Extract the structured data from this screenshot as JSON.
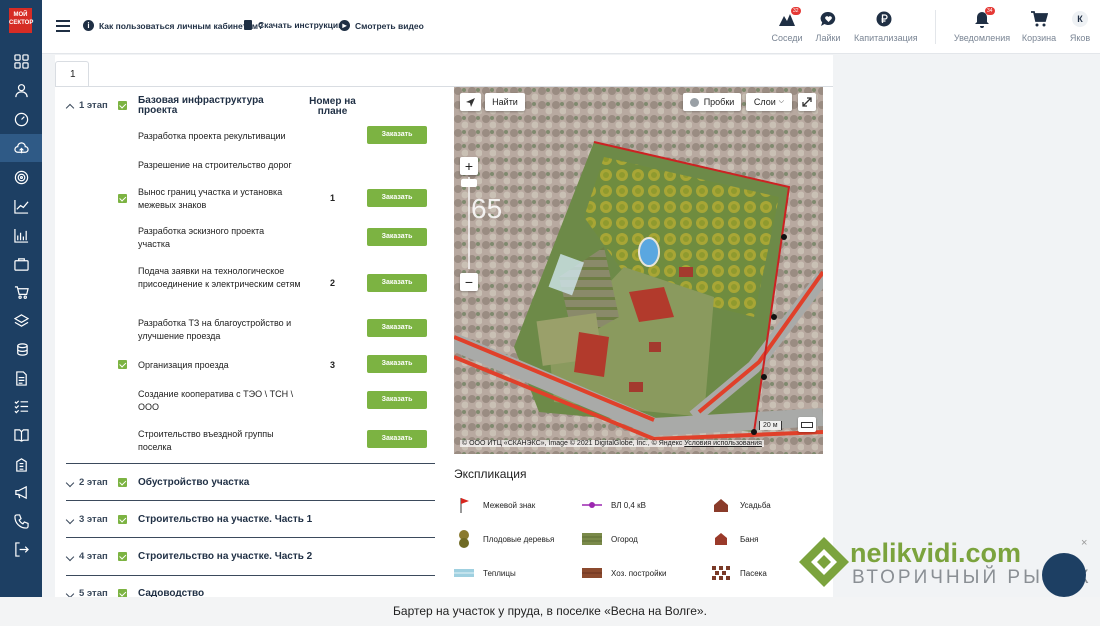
{
  "logo": {
    "line1": "МОЙ",
    "line2": "СЕКТОР"
  },
  "sidebar": {
    "icons": [
      "dashboard-icon",
      "user-icon",
      "gauge-icon",
      "cloud-upload-icon",
      "target-icon",
      "chart-line-icon",
      "bar-chart-icon",
      "briefcase-icon",
      "cart-icon",
      "layers-icon",
      "coins-icon",
      "document-icon",
      "checklist-icon",
      "book-icon",
      "building-icon",
      "megaphone-icon",
      "phone-icon",
      "logout-icon"
    ]
  },
  "topbar": {
    "links": [
      {
        "label": "Как пользоваться личным кабинетом?",
        "icon": "info-icon"
      },
      {
        "label": "Скачать инструкцию",
        "icon": "document-icon"
      },
      {
        "label": "Смотреть видео",
        "icon": "play-icon"
      }
    ],
    "buttons": [
      {
        "label": "Соседи",
        "badge": "32",
        "icon": "neighbors-icon"
      },
      {
        "label": "Лайки",
        "badge": "",
        "icon": "heart-chat-icon"
      },
      {
        "label": "Капитализация",
        "badge": "",
        "icon": "ruble-icon"
      },
      {
        "label": "Уведомления",
        "badge": "34",
        "icon": "bell-icon"
      },
      {
        "label": "Корзина",
        "badge": "",
        "icon": "cart-icon"
      },
      {
        "label": "Яков",
        "badge": "",
        "avatar": "К"
      }
    ]
  },
  "tab": {
    "value": "1"
  },
  "column_header": "Номер на плане",
  "order_label": "Заказать",
  "stage1": {
    "label": "1 этап",
    "title": "Базовая инфраструктура проекта",
    "items": [
      {
        "text": "Разработка проекта рекультивации",
        "num": "",
        "checked": false,
        "order": true
      },
      {
        "text": "Разрешение на строительство дорог",
        "num": "",
        "checked": false,
        "order": false
      },
      {
        "text": "Вынос границ участка и установка межевых знаков",
        "num": "1",
        "checked": true,
        "order": true
      },
      {
        "text": "Разработка эскизного проекта участка",
        "num": "",
        "checked": false,
        "order": true
      },
      {
        "text": "Подача заявки на технологическое присоединение к электрическим сетям",
        "num": "2",
        "checked": false,
        "order": true
      },
      {
        "text": "Разработка ТЗ на благоустройство и улучшение проезда",
        "num": "",
        "checked": false,
        "order": true
      },
      {
        "text": "Организация проезда",
        "num": "3",
        "checked": true,
        "order": true
      },
      {
        "text": "Создание кооператива с ТЭО \\ ТСН \\ ООО",
        "num": "",
        "checked": false,
        "order": true
      },
      {
        "text": "Строительство въездной группы поселка",
        "num": "",
        "checked": false,
        "order": true
      }
    ]
  },
  "stages": [
    {
      "label": "2 этап",
      "title": "Обустройство участка"
    },
    {
      "label": "3 этап",
      "title": "Строительство на участке. Часть 1"
    },
    {
      "label": "4 этап",
      "title": "Строительство на участке. Часть 2"
    },
    {
      "label": "5 этап",
      "title": "Садоводство"
    }
  ],
  "map": {
    "find_label": "Найти",
    "traffic_label": "Пробки",
    "layers_label": "Слои",
    "zoom_level": "65",
    "scale_label": "20 м",
    "copyright": "© ООО ИТЦ «СКАНЭКС», Image © 2021 DigitalGlobe, Inc., © Яндекс",
    "terms": "Условия использования"
  },
  "explication": {
    "title": "Экспликация",
    "items": [
      {
        "label": "Межевой знак",
        "icon": "flag-icon"
      },
      {
        "label": "ВЛ 0,4 кВ",
        "icon": "power-line-icon"
      },
      {
        "label": "Усадьба",
        "icon": "house-icon"
      },
      {
        "label": "Плодовые деревья",
        "icon": "tree-icon"
      },
      {
        "label": "Огород",
        "icon": "garden-icon"
      },
      {
        "label": "Баня",
        "icon": "bathhouse-icon"
      },
      {
        "label": "Теплицы",
        "icon": "greenhouse-icon"
      },
      {
        "label": "Хоз. постройки",
        "icon": "shed-icon"
      },
      {
        "label": "Пасека",
        "icon": "apiary-icon"
      }
    ]
  },
  "watermark": {
    "brand": "nelikvidi.com",
    "tagline": "ВТОРИЧНЫЙ РЫНОК",
    "close": "×"
  },
  "caption": "Бартер на участок у пруда, в поселке «Весна на Волге»."
}
